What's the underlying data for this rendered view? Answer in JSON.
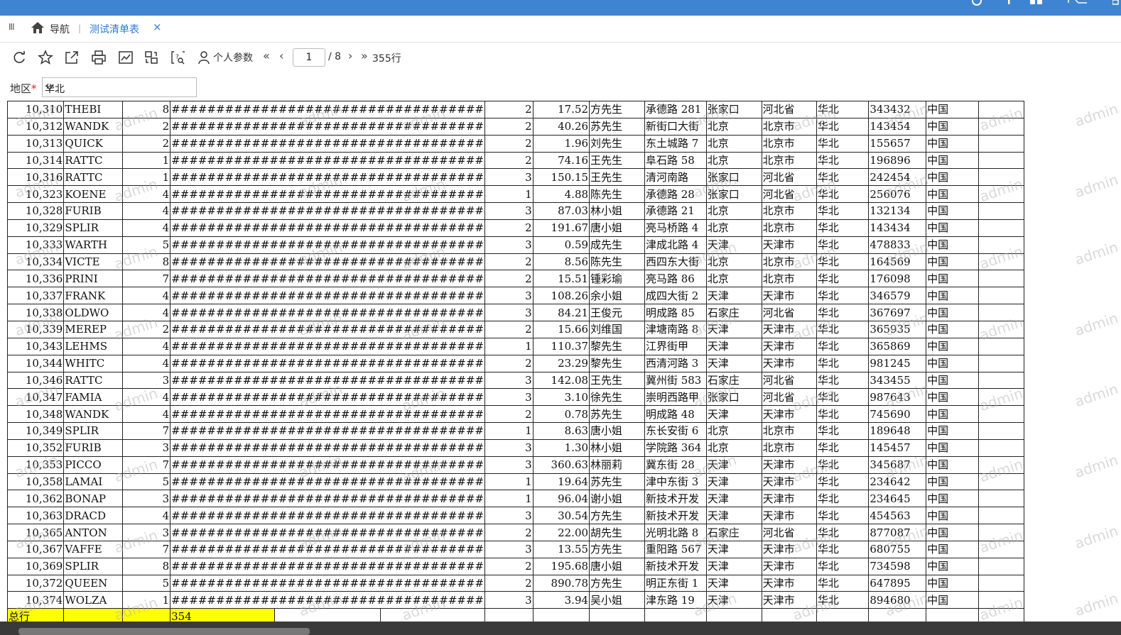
{
  "tabs": {
    "menu_glyph": "III",
    "nav_label": "导航",
    "sep": "|",
    "active_tab": "测试清单表",
    "close": "×"
  },
  "toolbar": {
    "icons": [
      "refresh-icon",
      "star-icon",
      "export-icon",
      "print-icon",
      "chart-icon",
      "switch-icon",
      "search-preview-icon",
      "user-params-icon"
    ],
    "param_label": "个人参数",
    "first": "«",
    "prev": "‹",
    "next": "›",
    "last": "»",
    "page": "1",
    "page_total": "/ 8",
    "row_count": "355行"
  },
  "filter": {
    "label": "地区",
    "required": "*",
    "value": "华北"
  },
  "grid": {
    "rows": [
      [
        "10,310",
        "THEBI",
        "8",
        "###################################",
        "2",
        "17.52",
        "方先生",
        "承德路 281",
        "张家口",
        "河北省",
        "华北",
        "343432",
        "中国"
      ],
      [
        "10,312",
        "WANDK",
        "2",
        "###################################",
        "2",
        "40.26",
        "苏先生",
        "新街口大街",
        "北京",
        "北京市",
        "华北",
        "143454",
        "中国"
      ],
      [
        "10,313",
        "QUICK",
        "2",
        "###################################",
        "2",
        "1.96",
        "刘先生",
        "东土城路 7",
        "北京",
        "北京市",
        "华北",
        "155657",
        "中国"
      ],
      [
        "10,314",
        "RATTC",
        "1",
        "###################################",
        "2",
        "74.16",
        "王先生",
        "阜石路 58",
        "北京",
        "北京市",
        "华北",
        "196896",
        "中国"
      ],
      [
        "10,316",
        "RATTC",
        "1",
        "###################################",
        "3",
        "150.15",
        "王先生",
        "清河南路",
        "张家口",
        "河北省",
        "华北",
        "242454",
        "中国"
      ],
      [
        "10,323",
        "KOENE",
        "4",
        "###################################",
        "1",
        "4.88",
        "陈先生",
        "承德路 28",
        "张家口",
        "河北省",
        "华北",
        "256076",
        "中国"
      ],
      [
        "10,328",
        "FURIB",
        "4",
        "###################################",
        "3",
        "87.03",
        "林小姐",
        "承德路 21",
        "北京",
        "北京市",
        "华北",
        "132134",
        "中国"
      ],
      [
        "10,329",
        "SPLIR",
        "4",
        "###################################",
        "2",
        "191.67",
        "唐小姐",
        "亮马桥路 4",
        "北京",
        "北京市",
        "华北",
        "143434",
        "中国"
      ],
      [
        "10,333",
        "WARTH",
        "5",
        "###################################",
        "3",
        "0.59",
        "成先生",
        "津成北路 4",
        "天津",
        "天津市",
        "华北",
        "478833",
        "中国"
      ],
      [
        "10,334",
        "VICTE",
        "8",
        "###################################",
        "2",
        "8.56",
        "陈先生",
        "西四东大街",
        "北京",
        "北京市",
        "华北",
        "164569",
        "中国"
      ],
      [
        "10,336",
        "PRINI",
        "7",
        "###################################",
        "2",
        "15.51",
        "锺彩瑜",
        "亮马路 86",
        "北京",
        "北京市",
        "华北",
        "176098",
        "中国"
      ],
      [
        "10,337",
        "FRANK",
        "4",
        "###################################",
        "3",
        "108.26",
        "余小姐",
        "成四大街 2",
        "天津",
        "天津市",
        "华北",
        "346579",
        "中国"
      ],
      [
        "10,338",
        "OLDWO",
        "4",
        "###################################",
        "3",
        "84.21",
        "王俊元",
        "明成路 85",
        "石家庄",
        "河北省",
        "华北",
        "367697",
        "中国"
      ],
      [
        "10,339",
        "MEREP",
        "2",
        "###################################",
        "2",
        "15.66",
        "刘维国",
        "津塘南路 8",
        "天津",
        "天津市",
        "华北",
        "365935",
        "中国"
      ],
      [
        "10,343",
        "LEHMS",
        "4",
        "###################################",
        "1",
        "110.37",
        "黎先生",
        "江界街甲",
        "天津",
        "天津市",
        "华北",
        "365869",
        "中国"
      ],
      [
        "10,344",
        "WHITC",
        "4",
        "###################################",
        "2",
        "23.29",
        "黎先生",
        "西清河路 3",
        "天津",
        "天津市",
        "华北",
        "981245",
        "中国"
      ],
      [
        "10,346",
        "RATTC",
        "3",
        "###################################",
        "3",
        "142.08",
        "王先生",
        "冀州街 583",
        "石家庄",
        "河北省",
        "华北",
        "343455",
        "中国"
      ],
      [
        "10,347",
        "FAMIA",
        "4",
        "###################################",
        "3",
        "3.10",
        "徐先生",
        "崇明西路甲",
        "张家口",
        "河北省",
        "华北",
        "987643",
        "中国"
      ],
      [
        "10,348",
        "WANDK",
        "4",
        "###################################",
        "2",
        "0.78",
        "苏先生",
        "明成路 48",
        "天津",
        "天津市",
        "华北",
        "745690",
        "中国"
      ],
      [
        "10,349",
        "SPLIR",
        "7",
        "###################################",
        "1",
        "8.63",
        "唐小姐",
        "东长安街 6",
        "北京",
        "北京市",
        "华北",
        "189648",
        "中国"
      ],
      [
        "10,352",
        "FURIB",
        "3",
        "###################################",
        "3",
        "1.30",
        "林小姐",
        "学院路 364",
        "北京",
        "北京市",
        "华北",
        "145457",
        "中国"
      ],
      [
        "10,353",
        "PICCO",
        "7",
        "###################################",
        "3",
        "360.63",
        "林丽莉",
        "冀东街 28",
        "天津",
        "天津市",
        "华北",
        "345687",
        "中国"
      ],
      [
        "10,358",
        "LAMAI",
        "5",
        "###################################",
        "1",
        "19.64",
        "苏先生",
        "津中东街 3",
        "天津",
        "天津市",
        "华北",
        "234642",
        "中国"
      ],
      [
        "10,362",
        "BONAP",
        "3",
        "###################################",
        "1",
        "96.04",
        "谢小姐",
        "新技术开发",
        "天津",
        "天津市",
        "华北",
        "234645",
        "中国"
      ],
      [
        "10,363",
        "DRACD",
        "4",
        "###################################",
        "3",
        "30.54",
        "方先生",
        "新技术开发",
        "天津",
        "天津市",
        "华北",
        "454563",
        "中国"
      ],
      [
        "10,365",
        "ANTON",
        "3",
        "###################################",
        "2",
        "22.00",
        "胡先生",
        "光明北路 8",
        "石家庄",
        "河北省",
        "华北",
        "877087",
        "中国"
      ],
      [
        "10,367",
        "VAFFE",
        "7",
        "###################################",
        "3",
        "13.55",
        "方先生",
        "重阳路 567",
        "天津",
        "天津市",
        "华北",
        "680755",
        "中国"
      ],
      [
        "10,369",
        "SPLIR",
        "8",
        "###################################",
        "2",
        "195.68",
        "唐小姐",
        "新技术开发",
        "天津",
        "天津市",
        "华北",
        "734598",
        "中国"
      ],
      [
        "10,372",
        "QUEEN",
        "5",
        "###################################",
        "2",
        "890.78",
        "方先生",
        "明正东街 1",
        "天津",
        "天津市",
        "华北",
        "647895",
        "中国"
      ],
      [
        "10,374",
        "WOLZA",
        "1",
        "###################################",
        "3",
        "3.94",
        "吴小姐",
        "津东路 19",
        "天津",
        "天津市",
        "华北",
        "894680",
        "中国"
      ]
    ],
    "total_label": "总行",
    "total_value": "354"
  },
  "watermark": "admin"
}
